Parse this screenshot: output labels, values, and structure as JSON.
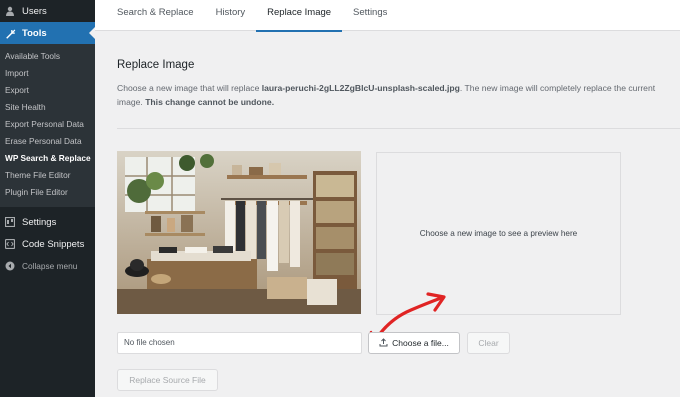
{
  "sidebar": {
    "users_label": "Users",
    "tools_label": "Tools",
    "tools_submenu": [
      "Available Tools",
      "Import",
      "Export",
      "Site Health",
      "Export Personal Data",
      "Erase Personal Data",
      "WP Search & Replace",
      "Theme File Editor",
      "Plugin File Editor"
    ],
    "settings_label": "Settings",
    "snippets_label": "Code Snippets",
    "collapse_label": "Collapse menu",
    "icons": {
      "users": "user-icon",
      "tools": "wrench-icon",
      "settings": "settings-icon",
      "snippets": "code-icon",
      "collapse": "collapse-arrow-icon"
    },
    "colors": {
      "background": "#1d2327",
      "active": "#2271b1"
    }
  },
  "tabs": [
    {
      "label": "Search & Replace"
    },
    {
      "label": "History"
    },
    {
      "label": "Replace Image",
      "active": true
    },
    {
      "label": "Settings"
    }
  ],
  "main": {
    "title": "Replace Image",
    "desc_prefix": "Choose a new image that will replace ",
    "filename": "laura-peruchi-2gLL2ZgBlcU-unsplash-scaled.jpg",
    "desc_middle": ". The new image will completely replace the current image. ",
    "desc_warning": "This change cannot be undone.",
    "preview_placeholder": "Choose a new image to see a preview here",
    "file_status": "No file chosen",
    "choose_button": "Choose a file...",
    "clear_button": "Clear",
    "replace_button": "Replace Source File",
    "arrow_color": "#e02424"
  }
}
